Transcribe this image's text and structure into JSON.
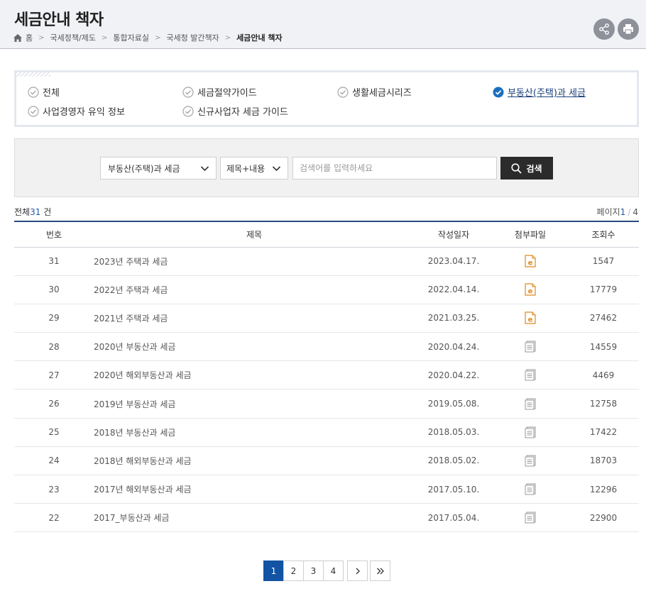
{
  "header": {
    "title": "세금안내 책자",
    "breadcrumb": [
      "홈",
      "국세정책/제도",
      "통합자료실",
      "국세청 발간책자",
      "세금안내 책자"
    ]
  },
  "categories": [
    {
      "label": "전체",
      "selected": false
    },
    {
      "label": "세금절약가이드",
      "selected": false
    },
    {
      "label": "생활세금시리즈",
      "selected": false
    },
    {
      "label": "부동산(주택)과 세금",
      "selected": true
    },
    {
      "label": "사업경영자 유익 정보",
      "selected": false
    },
    {
      "label": "신규사업자 세금 가이드",
      "selected": false
    }
  ],
  "search": {
    "category_value": "부동산(주택)과 세금",
    "field_value": "제목+내용",
    "placeholder": "검색어를 입력하세요",
    "button_label": "검색"
  },
  "summary": {
    "total_prefix": "전체",
    "total_count": "31",
    "total_suffix": " 건",
    "page_label": "페이지",
    "page_current": "1",
    "page_total": "4"
  },
  "table": {
    "headers": [
      "번호",
      "제목",
      "작성일자",
      "첨부파일",
      "조회수"
    ],
    "rows": [
      {
        "no": "31",
        "title": "2023년 주택과 세금",
        "date": "2023.04.17.",
        "file": "ebook",
        "views": "1547"
      },
      {
        "no": "30",
        "title": "2022년 주택과 세금",
        "date": "2022.04.14.",
        "file": "ebook",
        "views": "17779"
      },
      {
        "no": "29",
        "title": "2021년 주택과 세금",
        "date": "2021.03.25.",
        "file": "ebook",
        "views": "27462"
      },
      {
        "no": "28",
        "title": "2020년 부동산과 세금",
        "date": "2020.04.24.",
        "file": "document",
        "views": "14559"
      },
      {
        "no": "27",
        "title": "2020년 해외부동산과 세금",
        "date": "2020.04.22.",
        "file": "document",
        "views": "4469"
      },
      {
        "no": "26",
        "title": "2019년 부동산과 세금",
        "date": "2019.05.08.",
        "file": "document",
        "views": "12758"
      },
      {
        "no": "25",
        "title": "2018년 부동산과 세금",
        "date": "2018.05.03.",
        "file": "document",
        "views": "17422"
      },
      {
        "no": "24",
        "title": "2018년 해외부동산과 세금",
        "date": "2018.05.02.",
        "file": "document",
        "views": "18703"
      },
      {
        "no": "23",
        "title": "2017년 해외부동산과 세금",
        "date": "2017.05.10.",
        "file": "document",
        "views": "12296"
      },
      {
        "no": "22",
        "title": "2017_부동산과 세금",
        "date": "2017.05.04.",
        "file": "document",
        "views": "22900"
      }
    ]
  },
  "pagination": {
    "pages": [
      "1",
      "2",
      "3",
      "4"
    ],
    "current": "1"
  },
  "icons": {
    "home": "home-icon",
    "share": "share-icon",
    "print": "print-icon",
    "check": "check-circle-icon",
    "search": "search-icon",
    "chevron": "chevron-down-icon",
    "ebook": "ebook-file-icon",
    "document": "document-file-icon",
    "next": "chevron-right-icon",
    "last": "double-chevron-right-icon"
  },
  "colors": {
    "accent": "#1253a4",
    "check_active": "#1a6fc0",
    "header_bg": "#f1f2f5",
    "search_button": "#2b2b2b",
    "ebook_icon": "#e08a1e"
  }
}
